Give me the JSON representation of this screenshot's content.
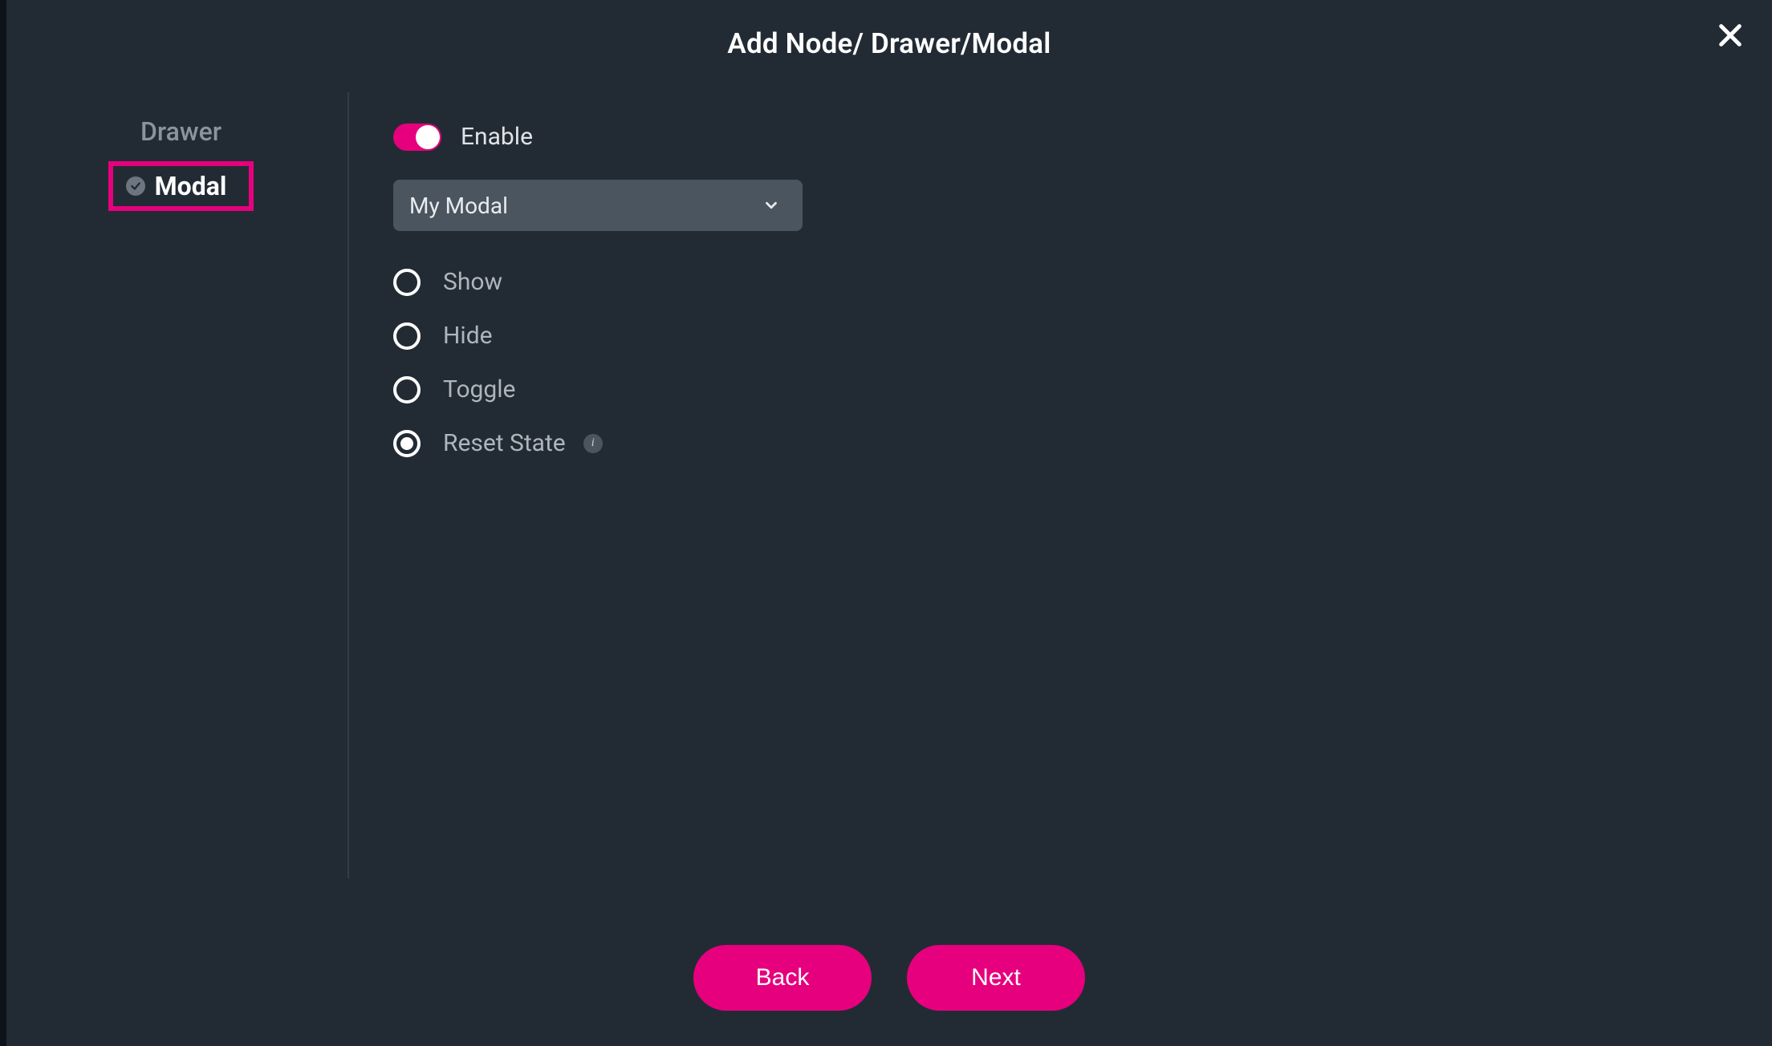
{
  "header": {
    "title": "Add Node/ Drawer/Modal"
  },
  "sidebar": {
    "items": [
      {
        "label": "Drawer",
        "active": false
      },
      {
        "label": "Modal",
        "active": true
      }
    ]
  },
  "content": {
    "enable_label": "Enable",
    "enable_value": true,
    "select_value": "My Modal",
    "radios": [
      {
        "label": "Show",
        "selected": false
      },
      {
        "label": "Hide",
        "selected": false
      },
      {
        "label": "Toggle",
        "selected": false
      },
      {
        "label": "Reset State",
        "selected": true,
        "info": true
      }
    ],
    "info_glyph": "i"
  },
  "footer": {
    "back_label": "Back",
    "next_label": "Next"
  },
  "colors": {
    "accent": "#e6007e",
    "panel": "#222b34",
    "input_bg": "#4a5560"
  },
  "icons": {
    "close": "close-icon",
    "chevron_down": "chevron-down-icon",
    "check": "check-icon",
    "info": "info-icon"
  }
}
